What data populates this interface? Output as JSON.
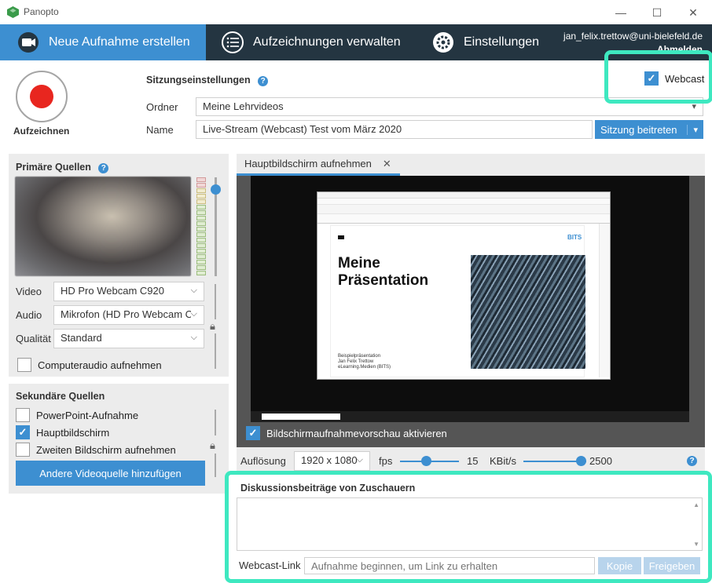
{
  "window": {
    "title": "Panopto"
  },
  "nav": {
    "tabs": [
      {
        "label": "Neue Aufnahme erstellen",
        "icon": "camera-icon"
      },
      {
        "label": "Aufzeichnungen verwalten",
        "icon": "list-icon"
      },
      {
        "label": "Einstellungen",
        "icon": "gear-icon"
      }
    ],
    "user_email": "jan_felix.trettow@uni-bielefeld.de",
    "logout": "Abmelden"
  },
  "record": {
    "label": "Aufzeichnen"
  },
  "session": {
    "title": "Sitzungseinstellungen",
    "folder_label": "Ordner",
    "folder_value": "Meine Lehrvideos",
    "name_label": "Name",
    "name_value": "Live-Stream (Webcast) Test vom März 2020",
    "join_button": "Sitzung beitreten",
    "webcast_label": "Webcast",
    "webcast_checked": true
  },
  "primary": {
    "title": "Primäre Quellen",
    "video_label": "Video",
    "video_value": "HD Pro Webcam C920",
    "audio_label": "Audio",
    "audio_value": "Mikrofon (HD Pro Webcam C",
    "quality_label": "Qualität",
    "quality_value": "Standard",
    "computer_audio": "Computeraudio aufnehmen",
    "computer_audio_checked": false
  },
  "secondary": {
    "title": "Sekundäre Quellen",
    "items": [
      {
        "label": "PowerPoint-Aufnahme",
        "checked": false
      },
      {
        "label": "Hauptbildschirm",
        "checked": true
      },
      {
        "label": "Zweiten Bildschirm aufnehmen",
        "checked": false
      }
    ],
    "add_button": "Andere Videoquelle hinzufügen"
  },
  "preview": {
    "tab_label": "Hauptbildschirm aufnehmen",
    "slide_title_1": "Meine",
    "slide_title_2": "Präsentation",
    "slide_footer_1": "Beispielpräsentation",
    "slide_footer_2": "Jan Felix Trettow",
    "slide_footer_3": "eLearning.Medien (BITS)",
    "enable_preview": "Bildschirmaufnahmevorschau aktivieren",
    "enable_preview_checked": true
  },
  "encoding": {
    "resolution_label": "Auflösung",
    "resolution_value": "1920 x 1080",
    "fps_label": "fps",
    "fps_value": "15",
    "bitrate_label": "KBit/s",
    "bitrate_value": "2500"
  },
  "discussion": {
    "title": "Diskussionsbeiträge von Zuschauern",
    "link_label": "Webcast-Link",
    "link_placeholder": "Aufnahme beginnen, um Link zu erhalten",
    "copy_button": "Kopie",
    "share_button": "Freigeben"
  }
}
